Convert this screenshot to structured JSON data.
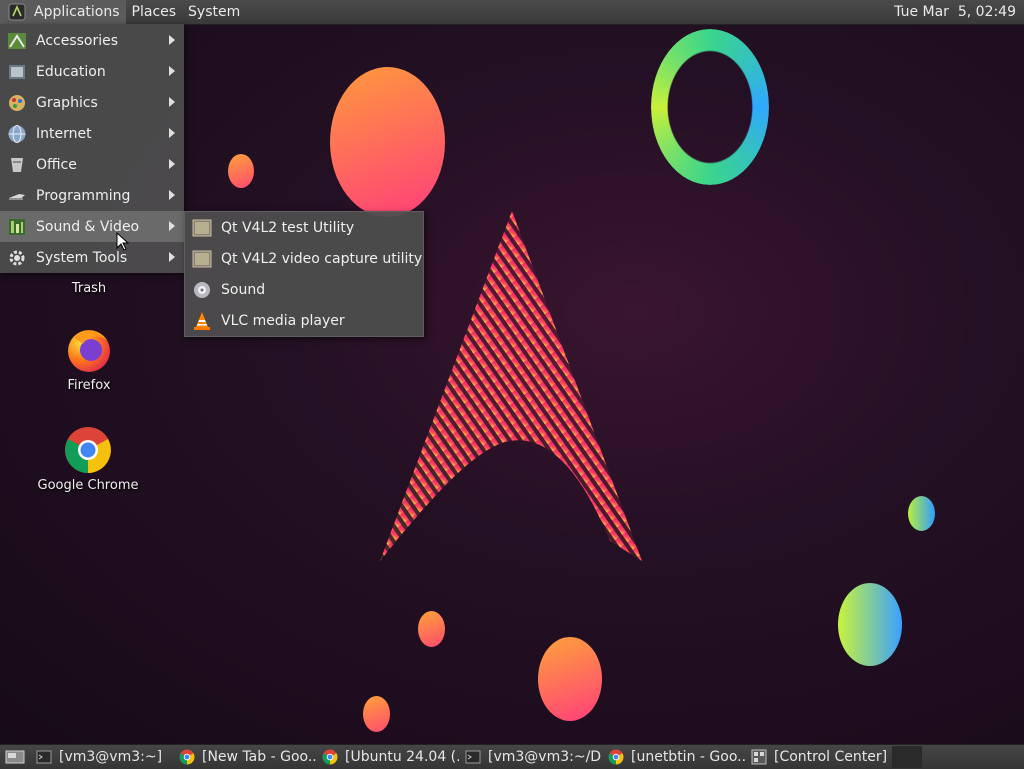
{
  "top_panel": {
    "menus": [
      "Applications",
      "Places",
      "System"
    ],
    "clock": "Tue Mar  5, 02:49"
  },
  "app_menu": {
    "items": [
      {
        "label": "Accessories",
        "icon": "accessories-icon"
      },
      {
        "label": "Education",
        "icon": "education-icon"
      },
      {
        "label": "Graphics",
        "icon": "graphics-icon"
      },
      {
        "label": "Internet",
        "icon": "internet-icon"
      },
      {
        "label": "Office",
        "icon": "office-icon"
      },
      {
        "label": "Programming",
        "icon": "programming-icon"
      },
      {
        "label": "Sound & Video",
        "icon": "sound-video-icon",
        "highlighted": true
      },
      {
        "label": "System Tools",
        "icon": "system-tools-icon"
      }
    ]
  },
  "sound_video_menu": {
    "items": [
      {
        "label": "Qt V4L2 test Utility",
        "icon": "qt-v4l2-icon"
      },
      {
        "label": "Qt V4L2 video capture utility",
        "icon": "qt-v4l2-capture-icon"
      },
      {
        "label": "Sound",
        "icon": "sound-icon"
      },
      {
        "label": "VLC media player",
        "icon": "vlc-icon"
      }
    ]
  },
  "desktop_icons": [
    {
      "label": "Trash",
      "icon": "trash-icon"
    },
    {
      "label": "Firefox",
      "icon": "firefox-icon"
    },
    {
      "label": "Google Chrome",
      "icon": "chrome-icon"
    }
  ],
  "taskbar": {
    "items": [
      {
        "label": "[vm3@vm3:~]",
        "icon": "terminal-icon"
      },
      {
        "label": "[New Tab - Goo...",
        "icon": "chrome-icon"
      },
      {
        "label": "[Ubuntu 24.04 (...",
        "icon": "chrome-icon"
      },
      {
        "label": "[vm3@vm3:~/D...",
        "icon": "terminal-icon"
      },
      {
        "label": "[unetbtin - Goo...",
        "icon": "chrome-icon"
      },
      {
        "label": "[Control Center]",
        "icon": "control-center-icon"
      }
    ]
  },
  "colors": {
    "panel": "#3e3e3e",
    "menu": "#4e4e4e",
    "highlight": "#6a6a6a",
    "accent_pink": "#e8206e",
    "accent_orange": "#ff8a3c"
  }
}
